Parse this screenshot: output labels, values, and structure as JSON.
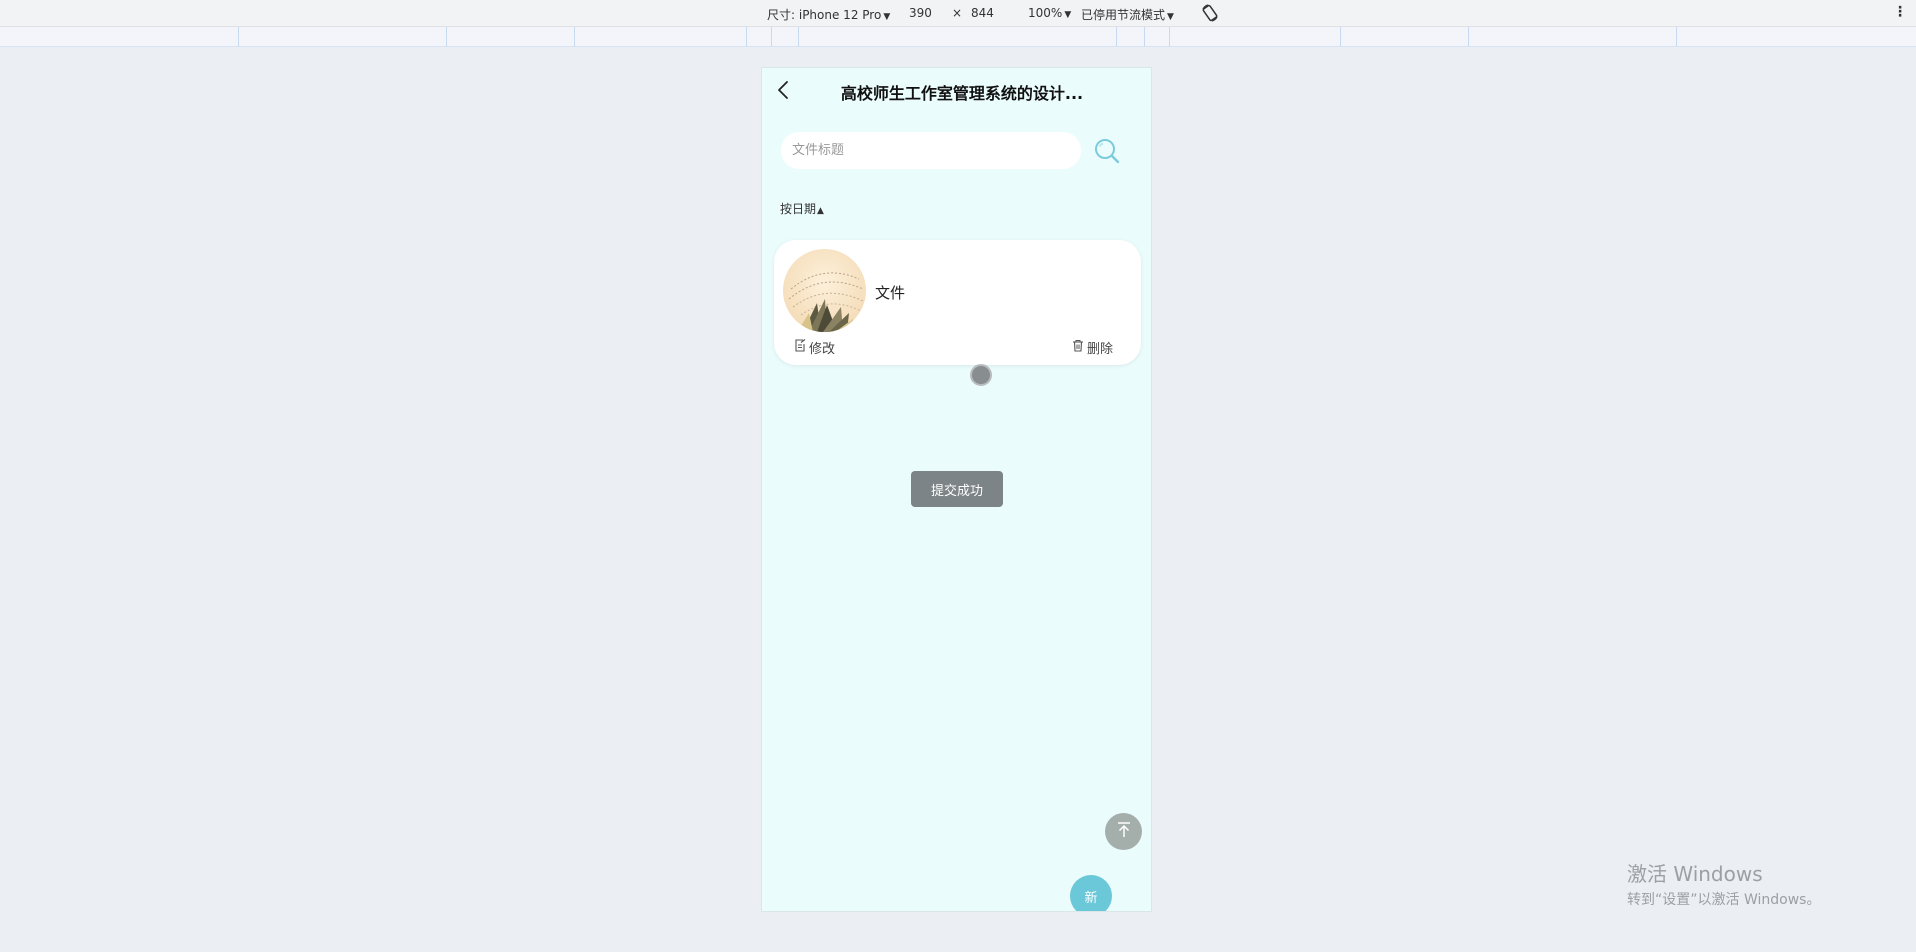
{
  "devtools": {
    "dimensions_label": "尺寸: iPhone 12 Pro",
    "width": "390",
    "times": "×",
    "height": "844",
    "zoom": "100%",
    "throttle": "已停用节流模式",
    "more_icon": "⋮"
  },
  "header": {
    "title": "高校师生工作室管理系统的设计..."
  },
  "search": {
    "placeholder": "文件标题"
  },
  "sort": {
    "label": "按日期",
    "arrow": "▲"
  },
  "list": {
    "items": [
      {
        "title": "文件",
        "edit_label": "修改",
        "delete_label": "删除"
      }
    ]
  },
  "toast": {
    "message": "提交成功"
  },
  "fab": {
    "new_label": "新"
  },
  "watermark": {
    "line1": "激活 Windows",
    "line2": "转到“设置”以激活 Windows。"
  },
  "colors": {
    "page_bg": "#ebfcfd",
    "accent": "#6ac8d8",
    "toast_bg": "#7d8487"
  }
}
